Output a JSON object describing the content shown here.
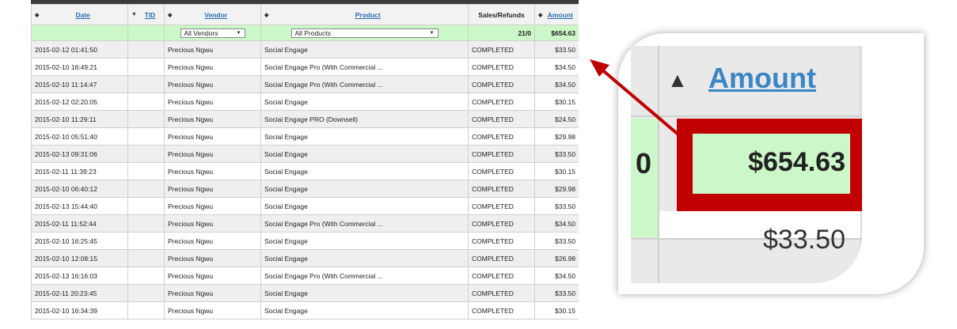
{
  "table": {
    "headers": {
      "date": "Date",
      "tid": "TID",
      "vendor": "Vendor",
      "product": "Product",
      "sales_refunds": "Sales/Refunds",
      "amount": "Amount"
    },
    "filters": {
      "vendor_select": "All Vendors",
      "product_select": "All Products",
      "sales_refunds_total": "21/0",
      "amount_total": "$654.63"
    },
    "rows": [
      {
        "date": "2015-02-12 01:41:50",
        "tid": "",
        "vendor": "Precious Ngwu",
        "product": "Social Engage",
        "status": "COMPLETED",
        "amount": "$33.50"
      },
      {
        "date": "2015-02-10 16:49:21",
        "tid": "",
        "vendor": "Precious Ngwu",
        "product": "Social Engage Pro (With Commercial ...",
        "status": "COMPLETED",
        "amount": "$34.50"
      },
      {
        "date": "2015-02-10 11:14:47",
        "tid": "",
        "vendor": "Precious Ngwu",
        "product": "Social Engage Pro (With Commercial ...",
        "status": "COMPLETED",
        "amount": "$34.50"
      },
      {
        "date": "2015-02-12 02:20:05",
        "tid": "",
        "vendor": "Precious Ngwu",
        "product": "Social Engage",
        "status": "COMPLETED",
        "amount": "$30.15"
      },
      {
        "date": "2015-02-10 11:29:11",
        "tid": "",
        "vendor": "Precious Ngwu",
        "product": "Social Engage PRO (Downsell)",
        "status": "COMPLETED",
        "amount": "$24.50"
      },
      {
        "date": "2015-02-10 05:51:40",
        "tid": "",
        "vendor": "Precious Ngwu",
        "product": "Social Engage",
        "status": "COMPLETED",
        "amount": "$29.98"
      },
      {
        "date": "2015-02-13 09:31:06",
        "tid": "",
        "vendor": "Precious Ngwu",
        "product": "Social Engage",
        "status": "COMPLETED",
        "amount": "$33.50"
      },
      {
        "date": "2015-02-11 11:39:23",
        "tid": "",
        "vendor": "Precious Ngwu",
        "product": "Social Engage",
        "status": "COMPLETED",
        "amount": "$30.15"
      },
      {
        "date": "2015-02-10 06:40:12",
        "tid": "",
        "vendor": "Precious Ngwu",
        "product": "Social Engage",
        "status": "COMPLETED",
        "amount": "$29.98"
      },
      {
        "date": "2015-02-13 15:44:40",
        "tid": "",
        "vendor": "Precious Ngwu",
        "product": "Social Engage",
        "status": "COMPLETED",
        "amount": "$33.50"
      },
      {
        "date": "2015-02-11 11:52:44",
        "tid": "",
        "vendor": "Precious Ngwu",
        "product": "Social Engage Pro (With Commercial ...",
        "status": "COMPLETED",
        "amount": "$34.50"
      },
      {
        "date": "2015-02-10 16:25:45",
        "tid": "",
        "vendor": "Precious Ngwu",
        "product": "Social Engage",
        "status": "COMPLETED",
        "amount": "$33.50"
      },
      {
        "date": "2015-02-10 12:08:15",
        "tid": "",
        "vendor": "Precious Ngwu",
        "product": "Social Engage",
        "status": "COMPLETED",
        "amount": "$26.98"
      },
      {
        "date": "2015-02-13 16:16:03",
        "tid": "",
        "vendor": "Precious Ngwu",
        "product": "Social Engage Pro (With Commercial ...",
        "status": "COMPLETED",
        "amount": "$34.50"
      },
      {
        "date": "2015-02-11 20:23:45",
        "tid": "",
        "vendor": "Precious Ngwu",
        "product": "Social Engage",
        "status": "COMPLETED",
        "amount": "$33.50"
      },
      {
        "date": "2015-02-10 16:34:39",
        "tid": "",
        "vendor": "Precious Ngwu",
        "product": "Social Engage",
        "status": "COMPLETED",
        "amount": "$30.15"
      }
    ]
  },
  "zoom": {
    "header_label": "Amount",
    "left_fragment": "0",
    "total": "$654.63",
    "next_amount": "$33.50",
    "highlight_color": "#c00000",
    "total_bg_color": "#ccf7c8"
  },
  "icons": {
    "sort": "sort-icon",
    "sort_desc": "sort-down-icon",
    "dropdown": "chevron-down-icon"
  }
}
